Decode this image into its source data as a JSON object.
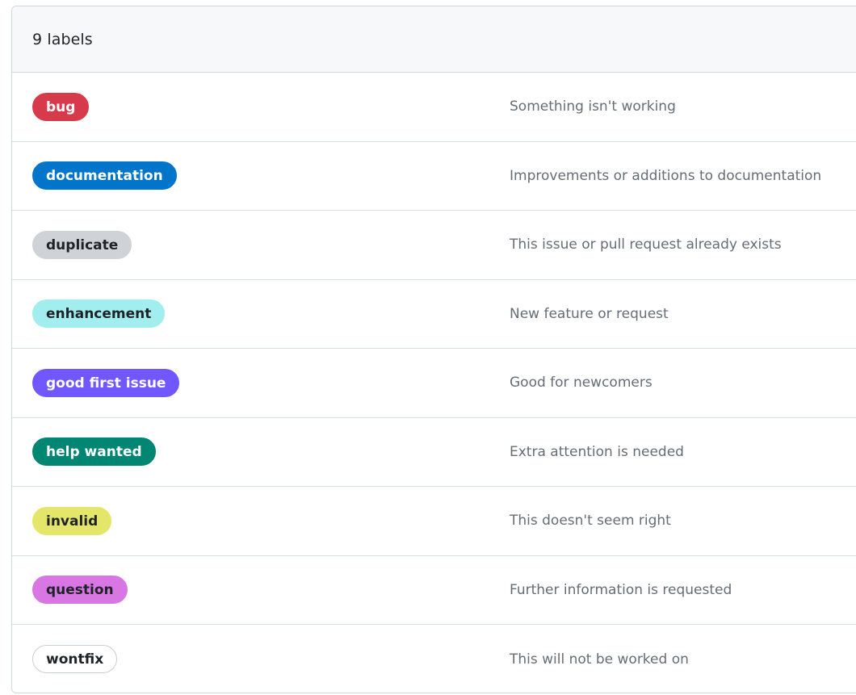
{
  "header": {
    "title": "9 labels"
  },
  "labels": [
    {
      "name": "bug",
      "description": "Something isn't working",
      "bg": "#d73a4a",
      "fg": "#ffffff",
      "border": "#d73a4a"
    },
    {
      "name": "documentation",
      "description": "Improvements or additions to documentation",
      "bg": "#0075ca",
      "fg": "#ffffff",
      "border": "#0075ca"
    },
    {
      "name": "duplicate",
      "description": "This issue or pull request already exists",
      "bg": "#cfd3d7",
      "fg": "#1f2328",
      "border": "#cfd3d7"
    },
    {
      "name": "enhancement",
      "description": "New feature or request",
      "bg": "#a2eeef",
      "fg": "#1f2328",
      "border": "#a2eeef"
    },
    {
      "name": "good first issue",
      "description": "Good for newcomers",
      "bg": "#7057ff",
      "fg": "#ffffff",
      "border": "#7057ff"
    },
    {
      "name": "help wanted",
      "description": "Extra attention is needed",
      "bg": "#008672",
      "fg": "#ffffff",
      "border": "#008672"
    },
    {
      "name": "invalid",
      "description": "This doesn't seem right",
      "bg": "#e4e669",
      "fg": "#1f2328",
      "border": "#e4e669"
    },
    {
      "name": "question",
      "description": "Further information is requested",
      "bg": "#d876e3",
      "fg": "#1f2328",
      "border": "#d876e3"
    },
    {
      "name": "wontfix",
      "description": "This will not be worked on",
      "bg": "#ffffff",
      "fg": "#1f2328",
      "border": "#c9ced4"
    }
  ]
}
